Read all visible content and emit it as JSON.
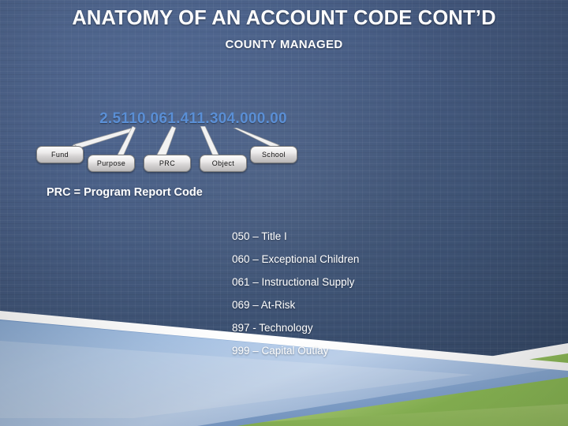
{
  "slide": {
    "title": "ANATOMY OF AN ACCOUNT CODE CONT’D",
    "subtitle": "COUNTY MANAGED",
    "account_code": "2.5110.061.411.304.000.00",
    "code_color": "#5a8fd6",
    "title_color": "#ffffff",
    "background_color": "#415679",
    "accent_green": "#8cc152",
    "accent_blue": "#a9c4e4"
  },
  "callouts": [
    {
      "label": "Fund",
      "name": "callout-fund"
    },
    {
      "label": "Purpose",
      "name": "callout-purpose"
    },
    {
      "label": "PRC",
      "name": "callout-prc"
    },
    {
      "label": "Object",
      "name": "callout-object"
    },
    {
      "label": "School",
      "name": "callout-school"
    }
  ],
  "body": {
    "prc_heading": "PRC = Program Report Code",
    "prc_items": [
      "050 – Title I",
      "060 – Exceptional Children",
      "061 – Instructional Supply",
      "069 – At-Risk",
      "897 - Technology",
      "999 – Capital Outlay"
    ]
  }
}
